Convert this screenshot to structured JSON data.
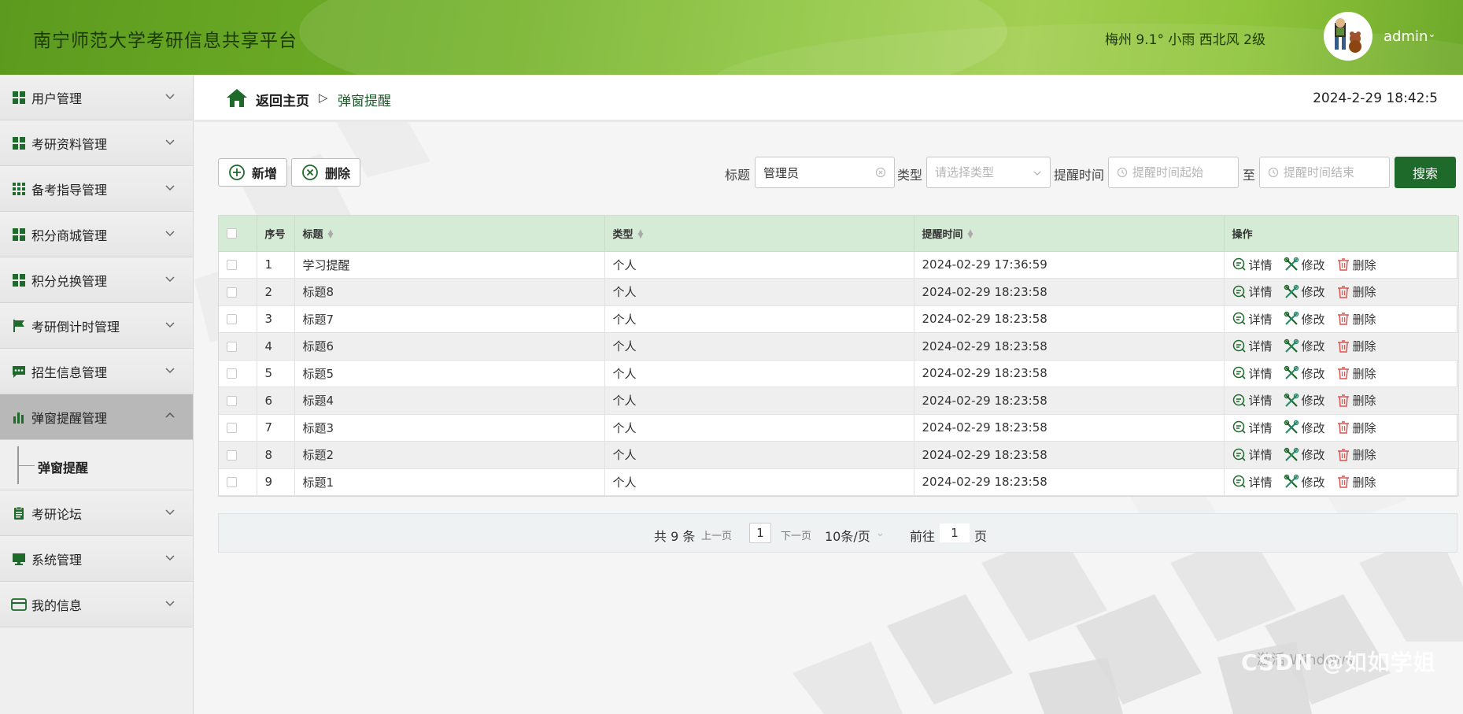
{
  "header": {
    "title": "南宁师范大学考研信息共享平台",
    "weather": "梅州 9.1° 小雨 西北风 2级",
    "user": "admin"
  },
  "sidebar": {
    "items": [
      {
        "label": "用户管理",
        "icon": "grid-icon"
      },
      {
        "label": "考研资料管理",
        "icon": "grid-icon"
      },
      {
        "label": "备考指导管理",
        "icon": "grid-9-icon"
      },
      {
        "label": "积分商城管理",
        "icon": "grid-icon"
      },
      {
        "label": "积分兑换管理",
        "icon": "grid-icon"
      },
      {
        "label": "考研倒计时管理",
        "icon": "flag-icon"
      },
      {
        "label": "招生信息管理",
        "icon": "chat-icon"
      },
      {
        "label": "弹窗提醒管理",
        "icon": "bar-chart-icon"
      },
      {
        "label": "考研论坛",
        "icon": "clipboard-icon"
      },
      {
        "label": "系统管理",
        "icon": "monitor-icon"
      },
      {
        "label": "我的信息",
        "icon": "card-icon"
      }
    ],
    "sub_item": "弹窗提醒"
  },
  "breadcrumb": {
    "home": "返回主页",
    "separator": "▷",
    "current": "弹窗提醒"
  },
  "clock": "2024-2-29 18:42:5",
  "toolbar": {
    "add_label": "新增",
    "delete_label": "删除",
    "title_label": "标题",
    "title_value": "管理员",
    "type_label": "类型",
    "type_placeholder": "请选择类型",
    "time_label": "提醒时间",
    "time_start_placeholder": "提醒时间起始",
    "to_label": "至",
    "time_end_placeholder": "提醒时间结束",
    "search_label": "搜索"
  },
  "table": {
    "headers": [
      "序号",
      "标题",
      "类型",
      "提醒时间",
      "操作"
    ],
    "ops": {
      "detail": "详情",
      "edit": "修改",
      "delete": "删除"
    },
    "rows": [
      {
        "no": "1",
        "title": "学习提醒",
        "type": "个人",
        "time": "2024-02-29 17:36:59"
      },
      {
        "no": "2",
        "title": "标题8",
        "type": "个人",
        "time": "2024-02-29 18:23:58"
      },
      {
        "no": "3",
        "title": "标题7",
        "type": "个人",
        "time": "2024-02-29 18:23:58"
      },
      {
        "no": "4",
        "title": "标题6",
        "type": "个人",
        "time": "2024-02-29 18:23:58"
      },
      {
        "no": "5",
        "title": "标题5",
        "type": "个人",
        "time": "2024-02-29 18:23:58"
      },
      {
        "no": "6",
        "title": "标题4",
        "type": "个人",
        "time": "2024-02-29 18:23:58"
      },
      {
        "no": "7",
        "title": "标题3",
        "type": "个人",
        "time": "2024-02-29 18:23:58"
      },
      {
        "no": "8",
        "title": "标题2",
        "type": "个人",
        "time": "2024-02-29 18:23:58"
      },
      {
        "no": "9",
        "title": "标题1",
        "type": "个人",
        "time": "2024-02-29 18:23:58"
      }
    ]
  },
  "pager": {
    "total": "共 9 条",
    "prev": "上一页",
    "page": "1",
    "next": "下一页",
    "page_size": "10条/页",
    "goto": "前往",
    "goto_page": "1",
    "page_unit": "页"
  },
  "watermark": {
    "windows": "激活 Windows",
    "csdn": "CSDN @如如学姐"
  },
  "colors": {
    "accent": "#1d6a2a",
    "header_green": "#73b228",
    "table_header": "#d6ebd6"
  }
}
